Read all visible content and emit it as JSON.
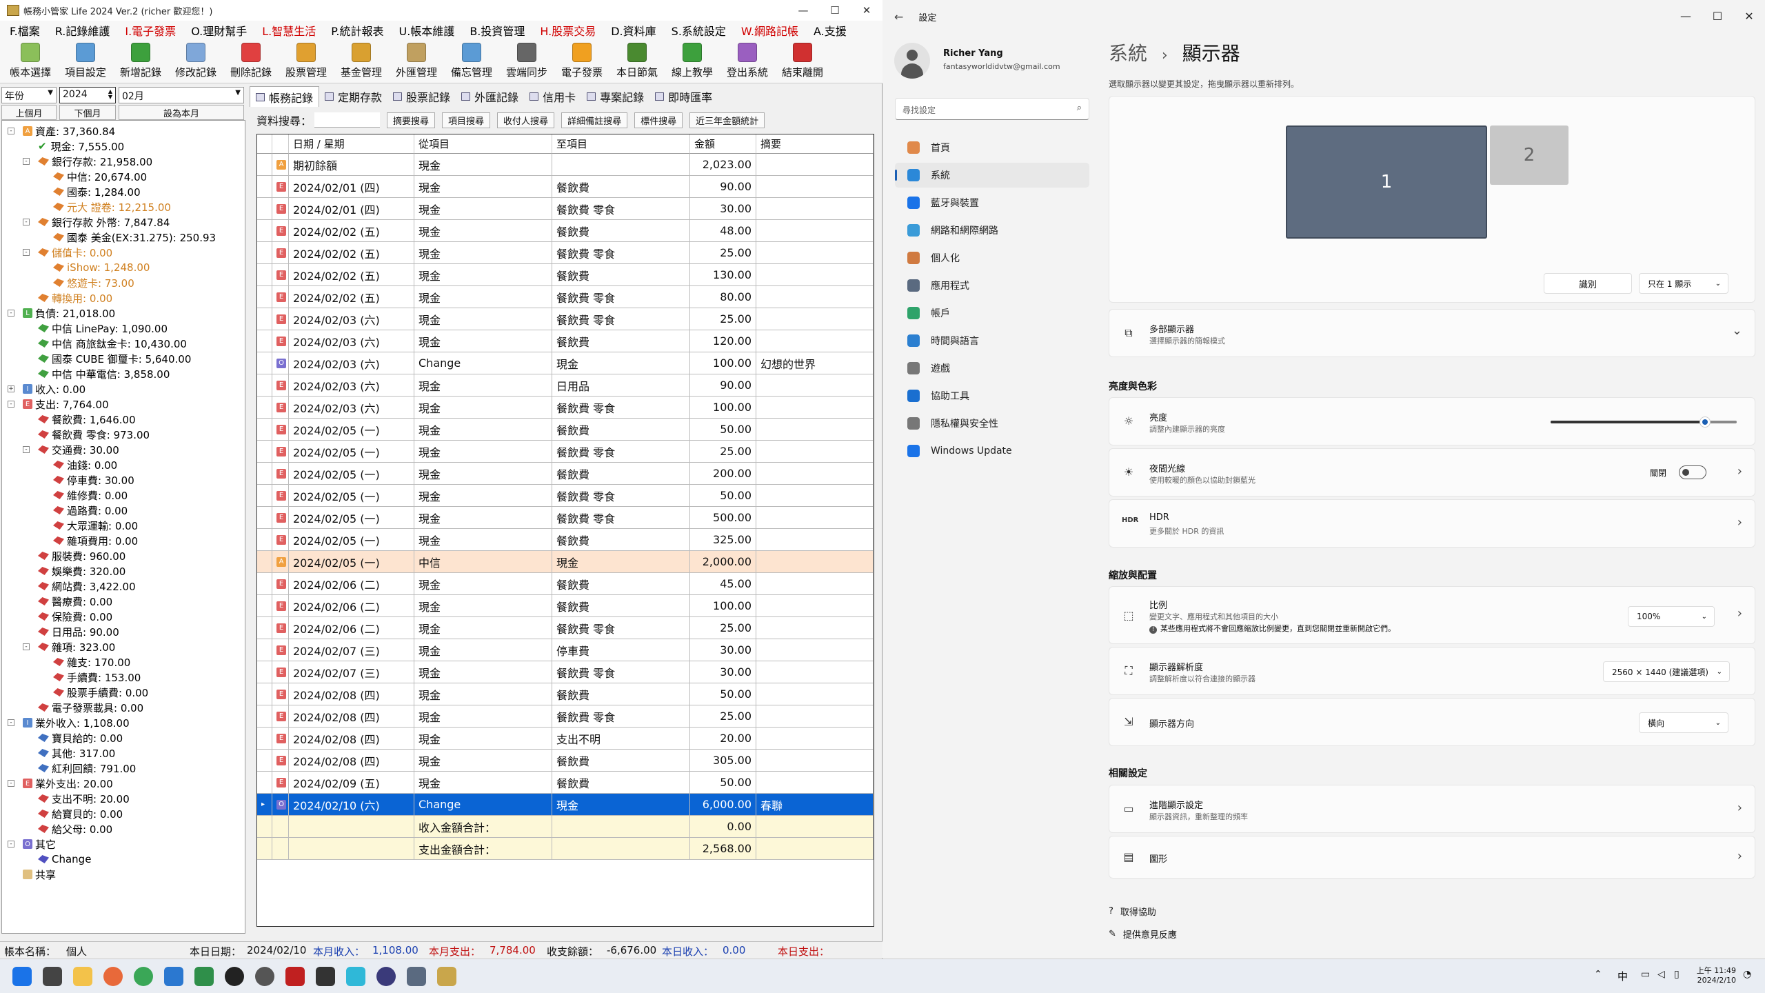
{
  "app": {
    "title": "帳務小管家 Life 2024 Ver.2 (richer 歡迎您！)",
    "menu": [
      {
        "label": "F.檔案",
        "color": "#000"
      },
      {
        "label": "R.記錄維護",
        "color": "#000"
      },
      {
        "label": "I.電子發票",
        "color": "#d00000"
      },
      {
        "label": "O.理財幫手",
        "color": "#000"
      },
      {
        "label": "L.智慧生活",
        "color": "#d00000"
      },
      {
        "label": "P.統計報表",
        "color": "#000"
      },
      {
        "label": "U.帳本維護",
        "color": "#000"
      },
      {
        "label": "B.投資管理",
        "color": "#000"
      },
      {
        "label": "H.股票交易",
        "color": "#d00000"
      },
      {
        "label": "D.資料庫",
        "color": "#000"
      },
      {
        "label": "S.系統設定",
        "color": "#000"
      },
      {
        "label": "W.網路記帳",
        "color": "#d00000"
      },
      {
        "label": "A.支援",
        "color": "#000"
      }
    ],
    "toolbar": [
      {
        "label": "帳本選擇",
        "icon": "ledger-icon",
        "color": "#8bbf5a"
      },
      {
        "label": "項目設定",
        "icon": "table-icon",
        "color": "#5b9bd5"
      },
      {
        "label": "新增記錄",
        "icon": "add-icon",
        "color": "#3da03d"
      },
      {
        "label": "修改記錄",
        "icon": "edit-icon",
        "color": "#7fa7d9"
      },
      {
        "label": "刪除記錄",
        "icon": "delete-icon",
        "color": "#e04040"
      },
      {
        "label": "股票管理",
        "icon": "stock-icon",
        "color": "#e0a030"
      },
      {
        "label": "基金管理",
        "icon": "fund-icon",
        "color": "#d9a030"
      },
      {
        "label": "外匯管理",
        "icon": "forex-icon",
        "color": "#c0a060"
      },
      {
        "label": "備忘管理",
        "icon": "memo-icon",
        "color": "#5b9bd5"
      },
      {
        "label": "雲端同步",
        "icon": "cloud-sync-icon",
        "color": "#666666"
      },
      {
        "label": "電子發票",
        "icon": "invoice-icon",
        "color": "#f0a020"
      },
      {
        "label": "本日節氣",
        "icon": "calendar-icon",
        "color": "#4a8a30"
      },
      {
        "label": "線上教學",
        "icon": "help-icon",
        "color": "#3da03d"
      },
      {
        "label": "登出系統",
        "icon": "logout-icon",
        "color": "#9a5fc0"
      },
      {
        "label": "結束離開",
        "icon": "exit-icon",
        "color": "#d03030"
      }
    ],
    "filter": {
      "period": "年份",
      "year": "2024",
      "month": "02月",
      "prev": "上個月",
      "next": "下個月",
      "current": "設為本月"
    },
    "tree": [
      {
        "label": "資產: 37,360.84",
        "level": 0,
        "box": "A",
        "boxc": "#f0a040",
        "color": "#000",
        "pm": "-"
      },
      {
        "label": "現金: 7,555.00",
        "level": 1,
        "icon": "check",
        "color": "#000"
      },
      {
        "label": "銀行存款: 21,958.00",
        "level": 1,
        "icon": "fold",
        "fc": "#e08030",
        "color": "#000",
        "pm": "-"
      },
      {
        "label": "中信: 20,674.00",
        "level": 2,
        "icon": "fold",
        "fc": "#e08030",
        "color": "#000"
      },
      {
        "label": "國泰: 1,284.00",
        "level": 2,
        "icon": "fold",
        "fc": "#e08030",
        "color": "#000"
      },
      {
        "label": "元大 證卷: 12,215.00",
        "level": 2,
        "icon": "fold",
        "fc": "#e08030",
        "color": "#d08020"
      },
      {
        "label": "銀行存款 外幣: 7,847.84",
        "level": 1,
        "icon": "fold",
        "fc": "#e08030",
        "color": "#000",
        "pm": "-"
      },
      {
        "label": "國泰 美金(EX:31.275): 250.93",
        "level": 2,
        "icon": "fold",
        "fc": "#e08030",
        "color": "#000"
      },
      {
        "label": "儲值卡: 0.00",
        "level": 1,
        "icon": "fold",
        "fc": "#e08030",
        "color": "#d08020",
        "pm": "-"
      },
      {
        "label": "iShow: 1,248.00",
        "level": 2,
        "icon": "fold",
        "fc": "#e08030",
        "color": "#d08020"
      },
      {
        "label": "悠遊卡: 73.00",
        "level": 2,
        "icon": "fold",
        "fc": "#e08030",
        "color": "#d08020"
      },
      {
        "label": "轉換用: 0.00",
        "level": 1,
        "icon": "fold",
        "fc": "#e08030",
        "color": "#d08020"
      },
      {
        "label": "負債: 21,018.00",
        "level": 0,
        "box": "L",
        "boxc": "#50b050",
        "color": "#000",
        "pm": "-"
      },
      {
        "label": "中信 LinePay: 1,090.00",
        "level": 1,
        "icon": "fold",
        "fc": "#40a040",
        "color": "#000"
      },
      {
        "label": "中信 商旅鈦金卡: 10,430.00",
        "level": 1,
        "icon": "fold",
        "fc": "#40a040",
        "color": "#000"
      },
      {
        "label": "國泰 CUBE 御璽卡: 5,640.00",
        "level": 1,
        "icon": "fold",
        "fc": "#40a040",
        "color": "#000"
      },
      {
        "label": "中信 中華電信: 3,858.00",
        "level": 1,
        "icon": "fold",
        "fc": "#40a040",
        "color": "#000"
      },
      {
        "label": "收入: 0.00",
        "level": 0,
        "box": "I",
        "boxc": "#5a8ad0",
        "color": "#000",
        "pm": "+"
      },
      {
        "label": "支出: 7,764.00",
        "level": 0,
        "box": "E",
        "boxc": "#e06060",
        "color": "#000",
        "pm": "-"
      },
      {
        "label": "餐飲費: 1,646.00",
        "level": 1,
        "icon": "fold",
        "fc": "#d04040",
        "color": "#000"
      },
      {
        "label": "餐飲費 零食: 973.00",
        "level": 1,
        "icon": "fold",
        "fc": "#d04040",
        "color": "#000"
      },
      {
        "label": "交通費: 30.00",
        "level": 1,
        "icon": "fold",
        "fc": "#d04040",
        "color": "#000",
        "pm": "-"
      },
      {
        "label": "油錢: 0.00",
        "level": 2,
        "icon": "fold",
        "fc": "#d04040",
        "color": "#000"
      },
      {
        "label": "停車費: 30.00",
        "level": 2,
        "icon": "fold",
        "fc": "#d04040",
        "color": "#000"
      },
      {
        "label": "維修費: 0.00",
        "level": 2,
        "icon": "fold",
        "fc": "#d04040",
        "color": "#000"
      },
      {
        "label": "過路費: 0.00",
        "level": 2,
        "icon": "fold",
        "fc": "#d04040",
        "color": "#000"
      },
      {
        "label": "大眾運輸: 0.00",
        "level": 2,
        "icon": "fold",
        "fc": "#d04040",
        "color": "#000"
      },
      {
        "label": "雜項費用: 0.00",
        "level": 2,
        "icon": "fold",
        "fc": "#d04040",
        "color": "#000"
      },
      {
        "label": "服裝費: 960.00",
        "level": 1,
        "icon": "fold",
        "fc": "#d04040",
        "color": "#000"
      },
      {
        "label": "娛樂費: 320.00",
        "level": 1,
        "icon": "fold",
        "fc": "#d04040",
        "color": "#000"
      },
      {
        "label": "網站費: 3,422.00",
        "level": 1,
        "icon": "fold",
        "fc": "#d04040",
        "color": "#000"
      },
      {
        "label": "醫療費: 0.00",
        "level": 1,
        "icon": "fold",
        "fc": "#d04040",
        "color": "#000"
      },
      {
        "label": "保險費: 0.00",
        "level": 1,
        "icon": "fold",
        "fc": "#d04040",
        "color": "#000"
      },
      {
        "label": "日用品: 90.00",
        "level": 1,
        "icon": "fold",
        "fc": "#d04040",
        "color": "#000"
      },
      {
        "label": "雜項: 323.00",
        "level": 1,
        "icon": "fold",
        "fc": "#d04040",
        "color": "#000",
        "pm": "-"
      },
      {
        "label": "雜支: 170.00",
        "level": 2,
        "icon": "fold",
        "fc": "#d04040",
        "color": "#000"
      },
      {
        "label": "手續費: 153.00",
        "level": 2,
        "icon": "fold",
        "fc": "#d04040",
        "color": "#000"
      },
      {
        "label": "股票手續費: 0.00",
        "level": 2,
        "icon": "fold",
        "fc": "#d04040",
        "color": "#000"
      },
      {
        "label": "電子發票載具: 0.00",
        "level": 1,
        "icon": "fold",
        "fc": "#d04040",
        "color": "#000"
      },
      {
        "label": "業外收入: 1,108.00",
        "level": 0,
        "box": "I",
        "boxc": "#5a8ad0",
        "color": "#000",
        "pm": "-"
      },
      {
        "label": "寶貝給的: 0.00",
        "level": 1,
        "icon": "fold",
        "fc": "#4070c0",
        "color": "#000"
      },
      {
        "label": "其他: 317.00",
        "level": 1,
        "icon": "fold",
        "fc": "#4070c0",
        "color": "#000"
      },
      {
        "label": "紅利回饋: 791.00",
        "level": 1,
        "icon": "fold",
        "fc": "#4070c0",
        "color": "#000"
      },
      {
        "label": "業外支出: 20.00",
        "level": 0,
        "box": "E",
        "boxc": "#e06060",
        "color": "#000",
        "pm": "-"
      },
      {
        "label": "支出不明: 20.00",
        "level": 1,
        "icon": "fold",
        "fc": "#d04040",
        "color": "#000"
      },
      {
        "label": "給寶貝的: 0.00",
        "level": 1,
        "icon": "fold",
        "fc": "#d04040",
        "color": "#000"
      },
      {
        "label": "給父母: 0.00",
        "level": 1,
        "icon": "fold",
        "fc": "#d04040",
        "color": "#000"
      },
      {
        "label": "其它",
        "level": 0,
        "box": "O",
        "boxc": "#7a70d0",
        "color": "#000",
        "pm": "-"
      },
      {
        "label": "Change",
        "level": 1,
        "icon": "fold",
        "fc": "#5050c0",
        "color": "#000"
      },
      {
        "label": "共享",
        "level": 0,
        "box": "",
        "boxc": "#e0c080",
        "color": "#000"
      }
    ],
    "tabs": [
      "帳務記錄",
      "定期存款",
      "股票記錄",
      "外匯記錄",
      "信用卡",
      "專案記錄",
      "即時匯率"
    ],
    "search": {
      "label": "資料搜尋：",
      "buttons": [
        "摘要搜尋",
        "項目搜尋",
        "收付人搜尋",
        "詳細備註搜尋",
        "標件搜尋",
        "近三年金額統計"
      ]
    },
    "columns": [
      "日期 / 星期",
      "從項目",
      "至項目",
      "金額",
      "摘要"
    ],
    "rows": [
      {
        "t": "A",
        "date": "期初餘額",
        "from": "現金",
        "to": "",
        "amt": "2,023.00",
        "memo": ""
      },
      {
        "t": "E",
        "date": "2024/02/01 (四)",
        "from": "現金",
        "to": "餐飲費",
        "amt": "90.00",
        "memo": ""
      },
      {
        "t": "E",
        "date": "2024/02/01 (四)",
        "from": "現金",
        "to": "餐飲費 零食",
        "amt": "30.00",
        "memo": ""
      },
      {
        "t": "E",
        "date": "2024/02/02 (五)",
        "from": "現金",
        "to": "餐飲費",
        "amt": "48.00",
        "memo": ""
      },
      {
        "t": "E",
        "date": "2024/02/02 (五)",
        "from": "現金",
        "to": "餐飲費 零食",
        "amt": "25.00",
        "memo": ""
      },
      {
        "t": "E",
        "date": "2024/02/02 (五)",
        "from": "現金",
        "to": "餐飲費",
        "amt": "130.00",
        "memo": ""
      },
      {
        "t": "E",
        "date": "2024/02/02 (五)",
        "from": "現金",
        "to": "餐飲費 零食",
        "amt": "80.00",
        "memo": ""
      },
      {
        "t": "E",
        "date": "2024/02/03 (六)",
        "from": "現金",
        "to": "餐飲費 零食",
        "amt": "25.00",
        "memo": ""
      },
      {
        "t": "E",
        "date": "2024/02/03 (六)",
        "from": "現金",
        "to": "餐飲費",
        "amt": "120.00",
        "memo": ""
      },
      {
        "t": "O",
        "date": "2024/02/03 (六)",
        "from": "Change",
        "to": "現金",
        "amt": "100.00",
        "memo": "幻想的世界"
      },
      {
        "t": "E",
        "date": "2024/02/03 (六)",
        "from": "現金",
        "to": "日用品",
        "amt": "90.00",
        "memo": ""
      },
      {
        "t": "E",
        "date": "2024/02/03 (六)",
        "from": "現金",
        "to": "餐飲費 零食",
        "amt": "100.00",
        "memo": ""
      },
      {
        "t": "E",
        "date": "2024/02/05 (一)",
        "from": "現金",
        "to": "餐飲費",
        "amt": "50.00",
        "memo": ""
      },
      {
        "t": "E",
        "date": "2024/02/05 (一)",
        "from": "現金",
        "to": "餐飲費 零食",
        "amt": "25.00",
        "memo": ""
      },
      {
        "t": "E",
        "date": "2024/02/05 (一)",
        "from": "現金",
        "to": "餐飲費",
        "amt": "200.00",
        "memo": ""
      },
      {
        "t": "E",
        "date": "2024/02/05 (一)",
        "from": "現金",
        "to": "餐飲費 零食",
        "amt": "50.00",
        "memo": ""
      },
      {
        "t": "E",
        "date": "2024/02/05 (一)",
        "from": "現金",
        "to": "餐飲費 零食",
        "amt": "500.00",
        "memo": ""
      },
      {
        "t": "E",
        "date": "2024/02/05 (一)",
        "from": "現金",
        "to": "餐飲費",
        "amt": "325.00",
        "memo": ""
      },
      {
        "t": "A",
        "date": "2024/02/05 (一)",
        "from": "中信",
        "to": "現金",
        "amt": "2,000.00",
        "memo": "",
        "hl": "#fde4d0"
      },
      {
        "t": "E",
        "date": "2024/02/06 (二)",
        "from": "現金",
        "to": "餐飲費",
        "amt": "45.00",
        "memo": ""
      },
      {
        "t": "E",
        "date": "2024/02/06 (二)",
        "from": "現金",
        "to": "餐飲費",
        "amt": "100.00",
        "memo": ""
      },
      {
        "t": "E",
        "date": "2024/02/06 (二)",
        "from": "現金",
        "to": "餐飲費 零食",
        "amt": "25.00",
        "memo": ""
      },
      {
        "t": "E",
        "date": "2024/02/07 (三)",
        "from": "現金",
        "to": "停車費",
        "amt": "30.00",
        "memo": ""
      },
      {
        "t": "E",
        "date": "2024/02/07 (三)",
        "from": "現金",
        "to": "餐飲費 零食",
        "amt": "30.00",
        "memo": ""
      },
      {
        "t": "E",
        "date": "2024/02/08 (四)",
        "from": "現金",
        "to": "餐飲費",
        "amt": "50.00",
        "memo": ""
      },
      {
        "t": "E",
        "date": "2024/02/08 (四)",
        "from": "現金",
        "to": "餐飲費 零食",
        "amt": "25.00",
        "memo": ""
      },
      {
        "t": "E",
        "date": "2024/02/08 (四)",
        "from": "現金",
        "to": "支出不明",
        "amt": "20.00",
        "memo": ""
      },
      {
        "t": "E",
        "date": "2024/02/08 (四)",
        "from": "現金",
        "to": "餐飲費",
        "amt": "305.00",
        "memo": ""
      },
      {
        "t": "E",
        "date": "2024/02/09 (五)",
        "from": "現金",
        "to": "餐飲費",
        "amt": "50.00",
        "memo": ""
      },
      {
        "t": "O",
        "date": "2024/02/10 (六)",
        "from": "Change",
        "to": "現金",
        "amt": "6,000.00",
        "memo": "春聯",
        "sel": true
      }
    ],
    "summary": [
      {
        "label": "收入金額合計：",
        "amt": "0.00"
      },
      {
        "label": "支出金額合計：",
        "amt": "2,568.00"
      }
    ],
    "status": {
      "ledger_label": "帳本名稱：",
      "ledger": "個人",
      "date_label": "本日日期：",
      "date": "2024/02/10",
      "inc_label": "本月收入：",
      "inc": "1,108.00",
      "exp_label": "本月支出：",
      "exp": "7,784.00",
      "bal_label": "收支餘額：",
      "bal": "-6,676.00",
      "dinc_label": "本日收入：",
      "dinc": "0.00",
      "dexp_label": "本日支出："
    }
  },
  "settings": {
    "title": "設定",
    "user": {
      "name": "Richer Yang",
      "email": "fantasyworldidvtw@gmail.com"
    },
    "search_placeholder": "尋找設定",
    "nav": [
      {
        "label": "首頁",
        "icon": "home-icon",
        "color": "#e0894a"
      },
      {
        "label": "系統",
        "icon": "system-icon",
        "color": "#2b88d8",
        "active": true
      },
      {
        "label": "藍牙與裝置",
        "icon": "bluetooth-icon",
        "color": "#1a73e8"
      },
      {
        "label": "網路和網際網路",
        "icon": "network-icon",
        "color": "#3a9bd8"
      },
      {
        "label": "個人化",
        "icon": "personalize-icon",
        "color": "#d07a40"
      },
      {
        "label": "應用程式",
        "icon": "apps-icon",
        "color": "#5a6a80"
      },
      {
        "label": "帳戶",
        "icon": "accounts-icon",
        "color": "#2ea36a"
      },
      {
        "label": "時間與語言",
        "icon": "time-icon",
        "color": "#2b7fd0"
      },
      {
        "label": "遊戲",
        "icon": "gaming-icon",
        "color": "#777777"
      },
      {
        "label": "協助工具",
        "icon": "accessibility-icon",
        "color": "#1a6fd0"
      },
      {
        "label": "隱私權與安全性",
        "icon": "privacy-icon",
        "color": "#777777"
      },
      {
        "label": "Windows Update",
        "icon": "update-icon",
        "color": "#1a73e8"
      }
    ],
    "breadcrumb_parent": "系統",
    "breadcrumb_sep": "›",
    "page_title": "顯示器",
    "arrange_hint": "選取顯示器以變更其設定，拖曳顯示器以重新排列。",
    "monitor1": "1",
    "monitor2": "2",
    "identify": "識別",
    "show_only": "只在 1 顯示",
    "multi": {
      "title": "多部顯示器",
      "sub": "選擇顯示器的簡報模式"
    },
    "sec_brightness": "亮度與色彩",
    "brightness": {
      "title": "亮度",
      "sub": "調整內建顯示器的亮度",
      "value": 0.83
    },
    "night": {
      "title": "夜間光線",
      "sub": "使用較暖的顏色以協助封鎖藍光",
      "state": "關閉"
    },
    "hdr": {
      "title": "HDR",
      "sub": "更多關於 HDR 的資訊"
    },
    "sec_scale": "縮放與配置",
    "scale": {
      "title": "比例",
      "sub": "變更文字、應用程式和其他項目的大小",
      "note": "某些應用程式將不會回應縮放比例變更，直到您關閉並重新開啟它們。",
      "value": "100%"
    },
    "resolution": {
      "title": "顯示器解析度",
      "sub": "調整解析度以符合連接的顯示器",
      "value": "2560 × 1440 (建議選項)"
    },
    "orientation": {
      "title": "顯示器方向",
      "value": "橫向"
    },
    "sec_related": "相關設定",
    "advanced": {
      "title": "進階顯示設定",
      "sub": "顯示器資訊，重新整理的頻率"
    },
    "graphics": {
      "title": "圖形"
    },
    "get_help": "取得協助",
    "feedback": "提供意見反應"
  },
  "taskbar": {
    "time": "上午 11:49",
    "date": "2024/2/10",
    "ime": "中"
  }
}
